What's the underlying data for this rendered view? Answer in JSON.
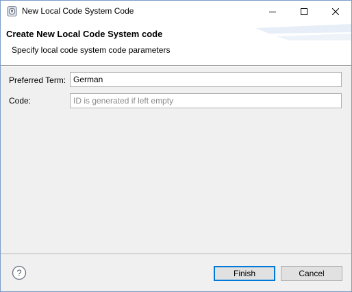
{
  "window": {
    "title": "New Local Code System Code"
  },
  "banner": {
    "title": "Create New Local Code System code",
    "description": "Specify local code system code parameters"
  },
  "form": {
    "preferred_term_label": "Preferred Term:",
    "preferred_term_value": "German",
    "code_label": "Code:",
    "code_value": "",
    "code_placeholder": "ID is generated if left empty"
  },
  "buttons": {
    "finish_label": "Finish",
    "cancel_label": "Cancel"
  },
  "icons": {
    "app": "app-icon",
    "help": "help-icon",
    "minimize": "minimize-icon",
    "maximize": "maximize-icon",
    "close": "close-icon"
  },
  "colors": {
    "accent": "#0078d7",
    "dialog_background": "#f0f0f0",
    "button_background": "#e1e1e1"
  }
}
